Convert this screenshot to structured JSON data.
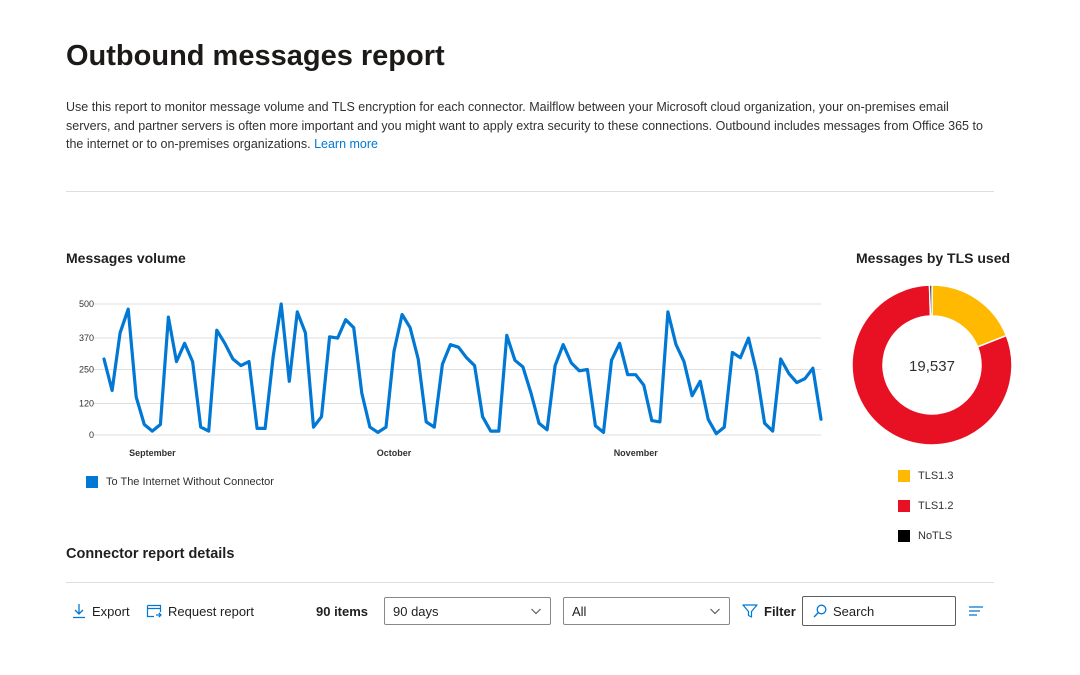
{
  "page": {
    "title": "Outbound messages report",
    "description": "Use this report to monitor message volume and TLS encryption for each connector. Mailflow between your Microsoft cloud organization, your on-premises email servers, and partner servers is often more important and you might want to apply extra security to these connections. Outbound includes messages from Office 365 to the internet or to on-premises organizations.",
    "learn_more": "Learn more"
  },
  "volume_chart": {
    "title": "Messages volume",
    "legend_label": "To The Internet Without Connector",
    "color": "#0078d4"
  },
  "tls_chart": {
    "title": "Messages by TLS used",
    "total": "19,537",
    "legend": [
      {
        "label": "TLS1.3",
        "color": "#ffb900"
      },
      {
        "label": "TLS1.2",
        "color": "#e81123"
      },
      {
        "label": "NoTLS",
        "color": "#000000"
      }
    ]
  },
  "details": {
    "title": "Connector report details",
    "export_label": "Export",
    "request_label": "Request report",
    "items_count": "90 items",
    "period_value": "90 days",
    "type_value": "All",
    "filter_label": "Filter",
    "search_placeholder": "Search"
  },
  "chart_data": [
    {
      "type": "line",
      "title": "Messages volume",
      "xlabel": "",
      "ylabel": "",
      "x_tick_labels": [
        "September",
        "October",
        "November"
      ],
      "y_ticks": [
        0,
        120,
        250,
        370,
        500
      ],
      "ylim": [
        0,
        500
      ],
      "grid": true,
      "legend": "bottom-left",
      "series": [
        {
          "name": "To The Internet Without Connector",
          "color": "#0078d4",
          "values": [
            290,
            170,
            390,
            480,
            145,
            40,
            15,
            40,
            450,
            280,
            350,
            280,
            30,
            15,
            400,
            350,
            290,
            265,
            280,
            25,
            25,
            300,
            500,
            205,
            470,
            390,
            30,
            70,
            375,
            370,
            440,
            410,
            160,
            30,
            10,
            30,
            320,
            460,
            410,
            290,
            50,
            30,
            270,
            345,
            335,
            295,
            265,
            70,
            15,
            15,
            380,
            285,
            260,
            160,
            45,
            20,
            265,
            345,
            275,
            245,
            250,
            35,
            10,
            285,
            350,
            230,
            230,
            190,
            55,
            50,
            470,
            345,
            280,
            150,
            205,
            60,
            5,
            30,
            315,
            295,
            370,
            240,
            45,
            15,
            290,
            235,
            200,
            215,
            255,
            60
          ]
        }
      ]
    },
    {
      "type": "pie",
      "title": "Messages by TLS used",
      "center_label": "19,537",
      "legend": "bottom",
      "slices": [
        {
          "label": "TLS1.3",
          "value": 19,
          "color": "#ffb900"
        },
        {
          "label": "TLS1.2",
          "value": 80.5,
          "color": "#e81123"
        },
        {
          "label": "NoTLS",
          "value": 0.5,
          "color": "#000000"
        }
      ]
    }
  ]
}
